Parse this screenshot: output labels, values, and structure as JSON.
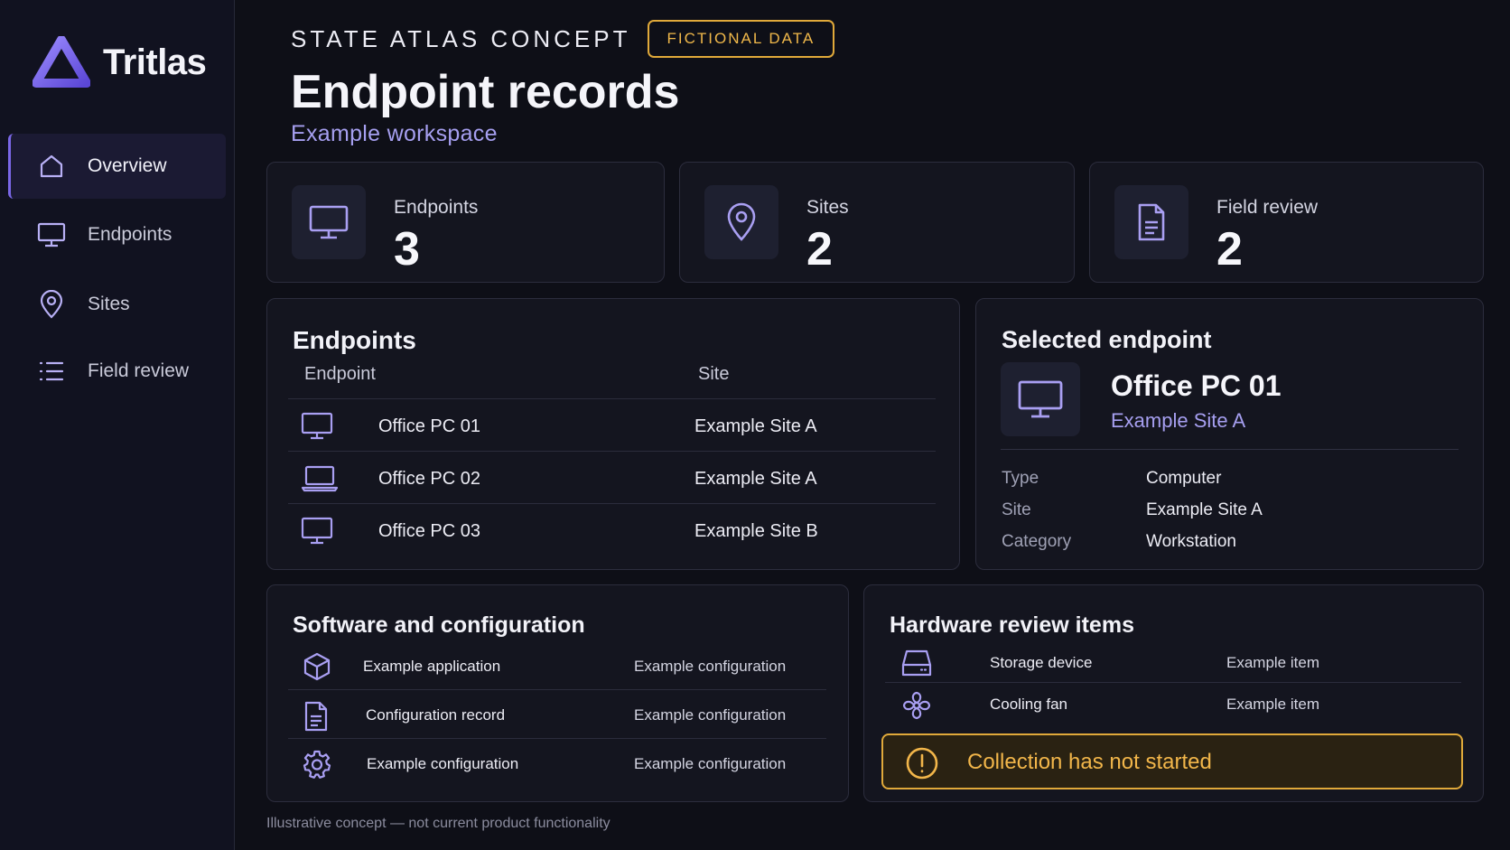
{
  "app": {
    "name": "Tritlas"
  },
  "sidebar": {
    "items": [
      {
        "label": "Overview",
        "icon": "home-icon",
        "active": true
      },
      {
        "label": "Endpoints",
        "icon": "monitor-icon",
        "active": false
      },
      {
        "label": "Sites",
        "icon": "map-pin-icon",
        "active": false
      },
      {
        "label": "Field review",
        "icon": "list-icon",
        "active": false
      }
    ]
  },
  "header": {
    "eyebrow": "STATE ATLAS CONCEPT",
    "badge": "FICTIONAL DATA",
    "title": "Endpoint records",
    "subtitle": "Example workspace"
  },
  "stats": [
    {
      "label": "Endpoints",
      "value": "3",
      "icon": "monitor-icon"
    },
    {
      "label": "Sites",
      "value": "2",
      "icon": "map-pin-icon"
    },
    {
      "label": "Field review",
      "value": "2",
      "icon": "document-icon"
    }
  ],
  "endpoints_panel": {
    "title": "Endpoints",
    "columns": [
      "Endpoint",
      "Site"
    ],
    "rows": [
      {
        "name": "Office PC 01",
        "site": "Example Site A",
        "icon": "monitor-icon"
      },
      {
        "name": "Office PC 02",
        "site": "Example Site A",
        "icon": "laptop-icon"
      },
      {
        "name": "Office PC 03",
        "site": "Example Site B",
        "icon": "monitor-icon"
      }
    ]
  },
  "selected": {
    "title": "Selected endpoint",
    "name": "Office PC 01",
    "site": "Example Site A",
    "icon": "monitor-icon",
    "fields": [
      {
        "key": "Type",
        "value": "Computer"
      },
      {
        "key": "Site",
        "value": "Example Site A"
      },
      {
        "key": "Category",
        "value": "Workstation"
      }
    ]
  },
  "software": {
    "title": "Software and configuration",
    "rows": [
      {
        "name": "Example application",
        "value": "Example configuration",
        "icon": "package-icon"
      },
      {
        "name": "Configuration record",
        "value": "Example configuration",
        "icon": "document-icon"
      },
      {
        "name": "Example configuration",
        "value": "Example configuration",
        "icon": "gear-icon"
      }
    ]
  },
  "hardware": {
    "title": "Hardware review items",
    "rows": [
      {
        "name": "Storage device",
        "value": "Example item",
        "icon": "hard-drive-icon"
      },
      {
        "name": "Cooling fan",
        "value": "Example item",
        "icon": "fan-icon"
      }
    ],
    "alert": "Collection has not started"
  },
  "footnote": "Illustrative concept — not current product functionality",
  "colors": {
    "accent": "#7a67e6",
    "warning": "#e0a93a",
    "background": "#0e0f17"
  }
}
